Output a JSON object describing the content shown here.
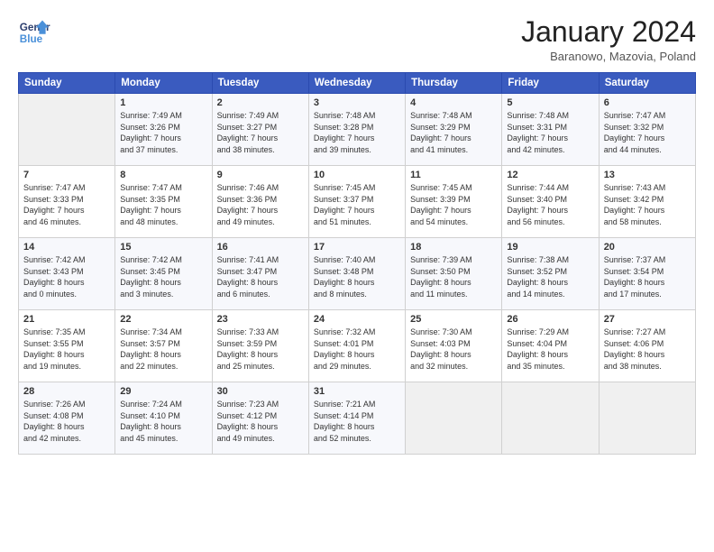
{
  "logo": {
    "line1": "General",
    "line2": "Blue"
  },
  "title": "January 2024",
  "subtitle": "Baranowo, Mazovia, Poland",
  "headers": [
    "Sunday",
    "Monday",
    "Tuesday",
    "Wednesday",
    "Thursday",
    "Friday",
    "Saturday"
  ],
  "weeks": [
    [
      {
        "day": "",
        "info": ""
      },
      {
        "day": "1",
        "info": "Sunrise: 7:49 AM\nSunset: 3:26 PM\nDaylight: 7 hours\nand 37 minutes."
      },
      {
        "day": "2",
        "info": "Sunrise: 7:49 AM\nSunset: 3:27 PM\nDaylight: 7 hours\nand 38 minutes."
      },
      {
        "day": "3",
        "info": "Sunrise: 7:48 AM\nSunset: 3:28 PM\nDaylight: 7 hours\nand 39 minutes."
      },
      {
        "day": "4",
        "info": "Sunrise: 7:48 AM\nSunset: 3:29 PM\nDaylight: 7 hours\nand 41 minutes."
      },
      {
        "day": "5",
        "info": "Sunrise: 7:48 AM\nSunset: 3:31 PM\nDaylight: 7 hours\nand 42 minutes."
      },
      {
        "day": "6",
        "info": "Sunrise: 7:47 AM\nSunset: 3:32 PM\nDaylight: 7 hours\nand 44 minutes."
      }
    ],
    [
      {
        "day": "7",
        "info": "Sunrise: 7:47 AM\nSunset: 3:33 PM\nDaylight: 7 hours\nand 46 minutes."
      },
      {
        "day": "8",
        "info": "Sunrise: 7:47 AM\nSunset: 3:35 PM\nDaylight: 7 hours\nand 48 minutes."
      },
      {
        "day": "9",
        "info": "Sunrise: 7:46 AM\nSunset: 3:36 PM\nDaylight: 7 hours\nand 49 minutes."
      },
      {
        "day": "10",
        "info": "Sunrise: 7:45 AM\nSunset: 3:37 PM\nDaylight: 7 hours\nand 51 minutes."
      },
      {
        "day": "11",
        "info": "Sunrise: 7:45 AM\nSunset: 3:39 PM\nDaylight: 7 hours\nand 54 minutes."
      },
      {
        "day": "12",
        "info": "Sunrise: 7:44 AM\nSunset: 3:40 PM\nDaylight: 7 hours\nand 56 minutes."
      },
      {
        "day": "13",
        "info": "Sunrise: 7:43 AM\nSunset: 3:42 PM\nDaylight: 7 hours\nand 58 minutes."
      }
    ],
    [
      {
        "day": "14",
        "info": "Sunrise: 7:42 AM\nSunset: 3:43 PM\nDaylight: 8 hours\nand 0 minutes."
      },
      {
        "day": "15",
        "info": "Sunrise: 7:42 AM\nSunset: 3:45 PM\nDaylight: 8 hours\nand 3 minutes."
      },
      {
        "day": "16",
        "info": "Sunrise: 7:41 AM\nSunset: 3:47 PM\nDaylight: 8 hours\nand 6 minutes."
      },
      {
        "day": "17",
        "info": "Sunrise: 7:40 AM\nSunset: 3:48 PM\nDaylight: 8 hours\nand 8 minutes."
      },
      {
        "day": "18",
        "info": "Sunrise: 7:39 AM\nSunset: 3:50 PM\nDaylight: 8 hours\nand 11 minutes."
      },
      {
        "day": "19",
        "info": "Sunrise: 7:38 AM\nSunset: 3:52 PM\nDaylight: 8 hours\nand 14 minutes."
      },
      {
        "day": "20",
        "info": "Sunrise: 7:37 AM\nSunset: 3:54 PM\nDaylight: 8 hours\nand 17 minutes."
      }
    ],
    [
      {
        "day": "21",
        "info": "Sunrise: 7:35 AM\nSunset: 3:55 PM\nDaylight: 8 hours\nand 19 minutes."
      },
      {
        "day": "22",
        "info": "Sunrise: 7:34 AM\nSunset: 3:57 PM\nDaylight: 8 hours\nand 22 minutes."
      },
      {
        "day": "23",
        "info": "Sunrise: 7:33 AM\nSunset: 3:59 PM\nDaylight: 8 hours\nand 25 minutes."
      },
      {
        "day": "24",
        "info": "Sunrise: 7:32 AM\nSunset: 4:01 PM\nDaylight: 8 hours\nand 29 minutes."
      },
      {
        "day": "25",
        "info": "Sunrise: 7:30 AM\nSunset: 4:03 PM\nDaylight: 8 hours\nand 32 minutes."
      },
      {
        "day": "26",
        "info": "Sunrise: 7:29 AM\nSunset: 4:04 PM\nDaylight: 8 hours\nand 35 minutes."
      },
      {
        "day": "27",
        "info": "Sunrise: 7:27 AM\nSunset: 4:06 PM\nDaylight: 8 hours\nand 38 minutes."
      }
    ],
    [
      {
        "day": "28",
        "info": "Sunrise: 7:26 AM\nSunset: 4:08 PM\nDaylight: 8 hours\nand 42 minutes."
      },
      {
        "day": "29",
        "info": "Sunrise: 7:24 AM\nSunset: 4:10 PM\nDaylight: 8 hours\nand 45 minutes."
      },
      {
        "day": "30",
        "info": "Sunrise: 7:23 AM\nSunset: 4:12 PM\nDaylight: 8 hours\nand 49 minutes."
      },
      {
        "day": "31",
        "info": "Sunrise: 7:21 AM\nSunset: 4:14 PM\nDaylight: 8 hours\nand 52 minutes."
      },
      {
        "day": "",
        "info": ""
      },
      {
        "day": "",
        "info": ""
      },
      {
        "day": "",
        "info": ""
      }
    ]
  ]
}
